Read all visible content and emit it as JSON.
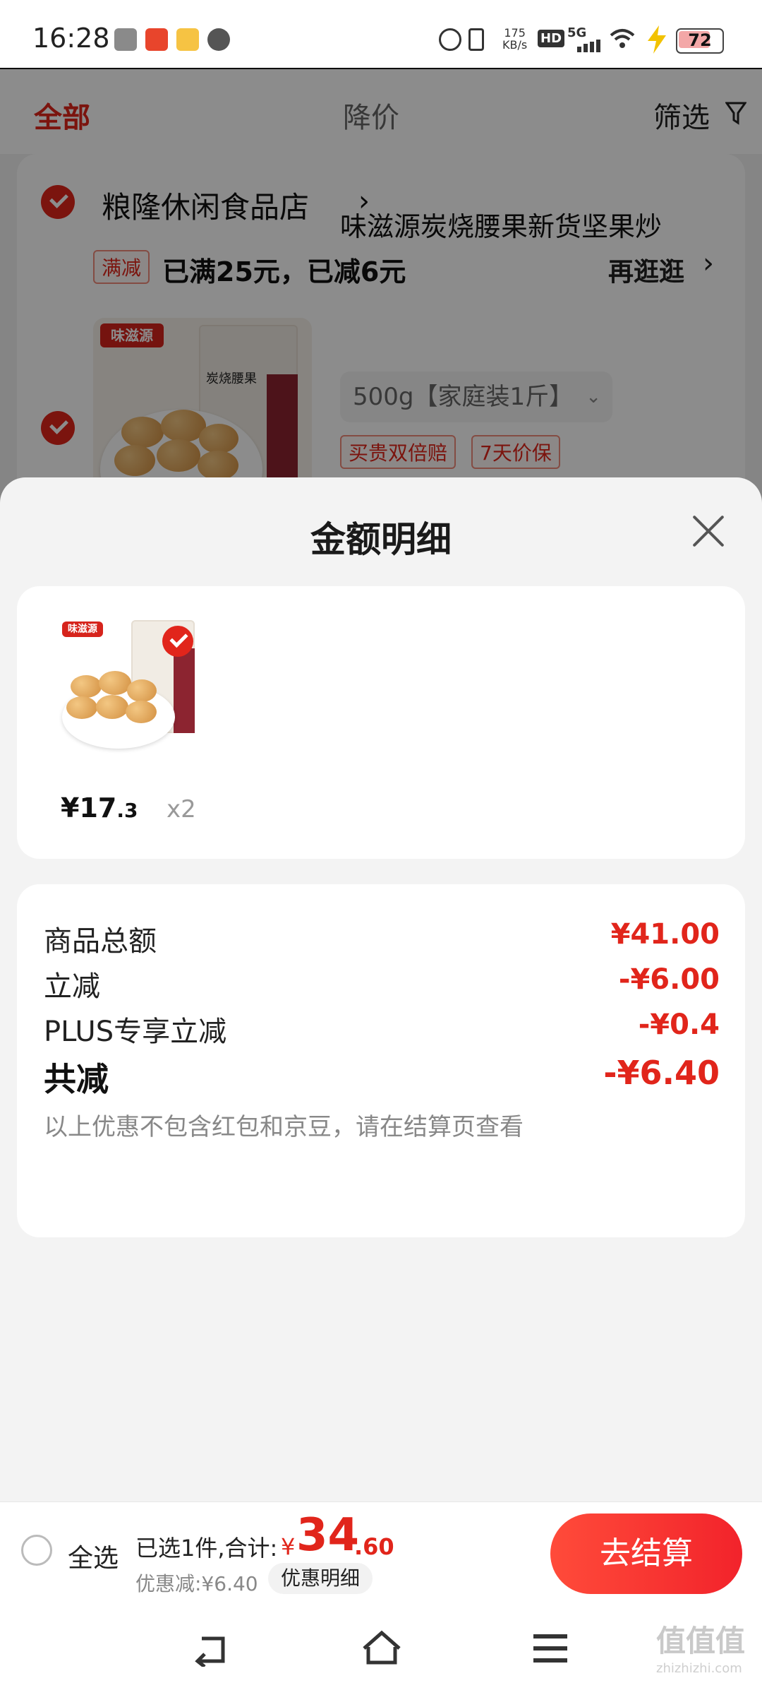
{
  "status_bar": {
    "time": "16:28",
    "net_speed_value": "175",
    "net_speed_unit": "KB/s",
    "hd_label": "HD",
    "network_type": "5G",
    "battery": "72"
  },
  "filter_bar": {
    "tabs": [
      "全部",
      "降价"
    ],
    "filter_label": "筛选"
  },
  "store": {
    "name": "粮隆休闲食品店",
    "promo_tag": "满减",
    "promo_text": "已满25元，已减6元",
    "promo_link": "再逛逛"
  },
  "product": {
    "title": "味滋源炭烧腰果新货坚果炒",
    "variant": "500g【家庭装1斤】",
    "tags": [
      "买贵双倍赔",
      "7天价保"
    ],
    "brand_logo": "味滋源",
    "pack_label": "炭烧腰果"
  },
  "sheet": {
    "title": "金额明细",
    "item": {
      "price_int": "¥17",
      "price_dec": ".3",
      "qty": "x2"
    },
    "rows": [
      {
        "label": "商品总额",
        "value": "¥41.00"
      },
      {
        "label": "立减",
        "value": "-¥6.00"
      },
      {
        "label": "PLUS专享立减",
        "value": "-¥0.4"
      }
    ],
    "total_label": "共减",
    "total_value": "-¥6.40",
    "note": "以上优惠不包含红包和京豆，请在结算页查看"
  },
  "checkout": {
    "select_all": "全选",
    "selected_text": "已选1件,合计:",
    "total_symbol": "¥",
    "total_int": "34",
    "total_dec": ".60",
    "discount_text": "优惠减:¥6.40",
    "discount_detail_btn": "优惠明细",
    "checkout_btn": "去结算"
  },
  "watermark": {
    "brand": "值值值",
    "domain": "zhizhizhi.com"
  },
  "colors": {
    "accent": "#e1251b",
    "overlay": "rgba(0,0,0,0.45)"
  }
}
